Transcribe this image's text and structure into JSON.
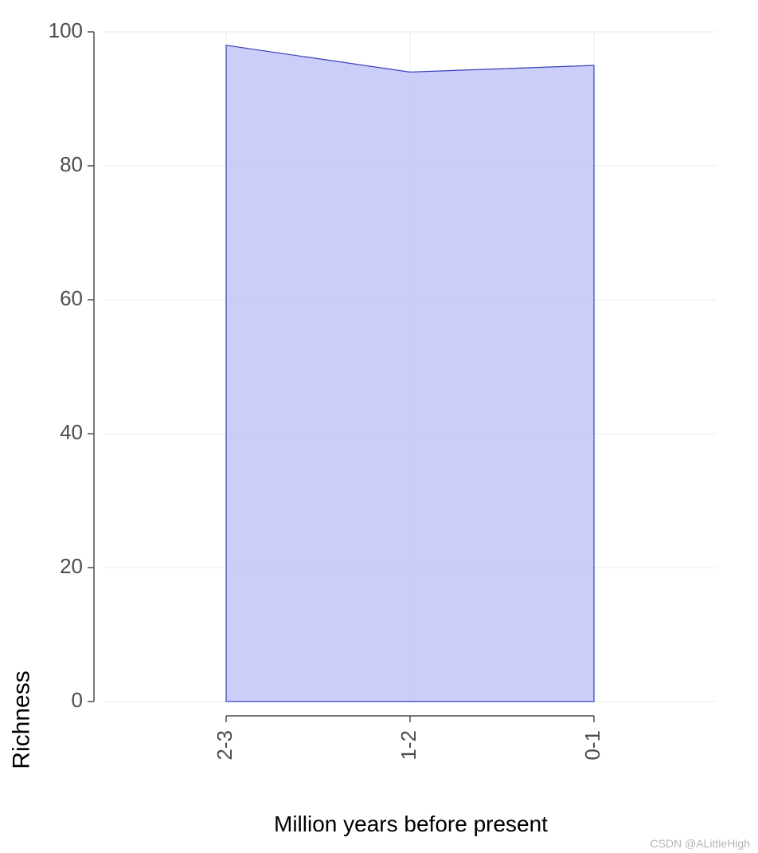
{
  "chart_data": {
    "type": "area",
    "categories": [
      "2-3",
      "1-2",
      "0-1"
    ],
    "values": [
      98,
      94,
      95
    ],
    "title": "",
    "xlabel": "Million years before present",
    "ylabel": "Richness",
    "ylim": [
      0,
      100
    ],
    "yticks": [
      0,
      20,
      40,
      60,
      80,
      100
    ],
    "fill": "#b8bdf5",
    "stroke": "#3a3fbd",
    "grid_color": "#ebebeb",
    "axis_color": "#4d4d4d",
    "tick_label_color": "#4d4d4d"
  },
  "watermark": "CSDN @ALittleHigh"
}
